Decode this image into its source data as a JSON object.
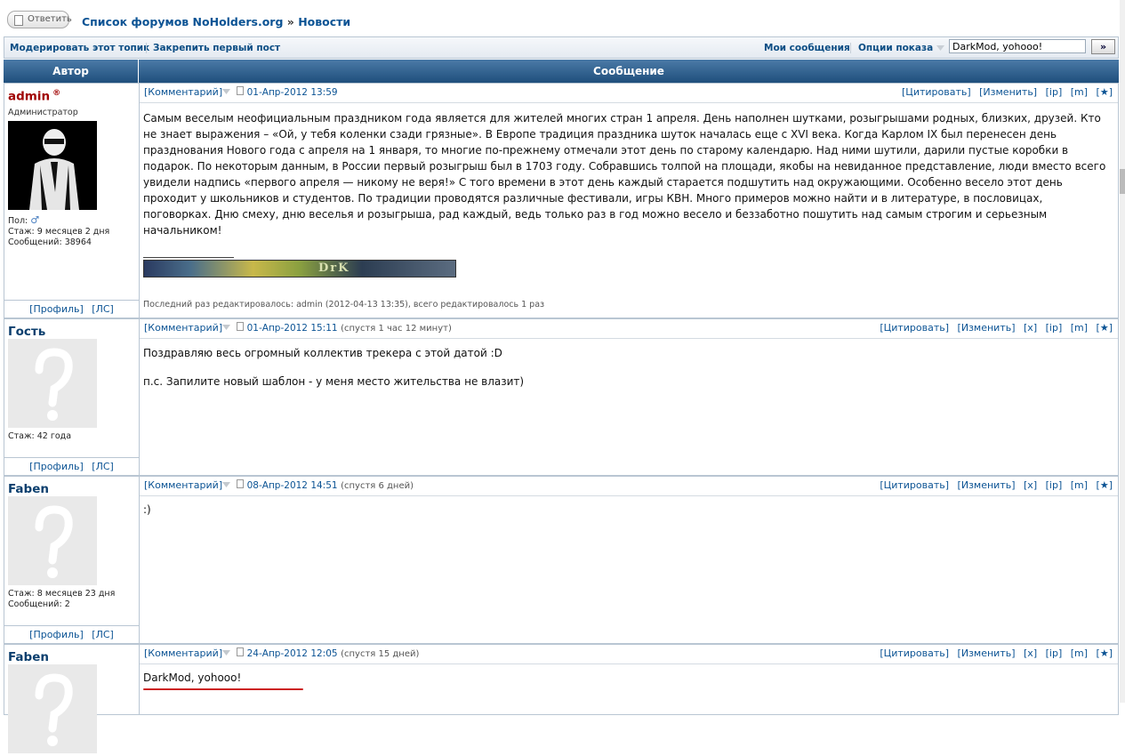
{
  "topbar": {
    "reply_label": "Ответить",
    "breadcrumb_forum": "Список форумов NoHolders.org",
    "breadcrumb_sep": "»",
    "breadcrumb_section": "Новости"
  },
  "toolbar": {
    "moderate": "Модерировать этот топик",
    "pin_first": "Закрепить первый пост",
    "my_posts": "Мои сообщения",
    "view_options": "Опции показа",
    "search_value": "DarkMod, yohooo!",
    "go_label": "»"
  },
  "table_headers": {
    "author": "Автор",
    "message": "Сообщение"
  },
  "post_actions": {
    "comment": "[Комментарий]",
    "quote": "[Цитировать]",
    "edit": "[Изменить]",
    "delete": "[x]",
    "ip": "[ip]",
    "m": "[m]",
    "star": "[★]",
    "profile": "[Профиль]",
    "pm": "[ЛС]"
  },
  "posts": [
    {
      "author": "admin",
      "role": "Администратор",
      "gender_label": "Пол:",
      "stat1": "Стаж: 9 месяцев 2 дня",
      "stat2": "Сообщений: 38964",
      "date": "01-Апр-2012 13:59",
      "body": "Самым веселым неофициальным праздником года является для жителей многих стран 1 апреля. День наполнен шутками, розыгрышами родных, близких, друзей. Кто не знает выражения – «Ой, у тебя коленки сзади грязные». В Европе традиция праздника шуток началась еще с XVI века. Когда Карлом IX был перенесен день празднования Нового года с апреля на 1 января, то многие по-прежнему отмечали этот день по старому календарю. Над ними шутили, дарили пустые коробки в подарок. По некоторым данным, в России первый розыгрыш был в 1703 году. Собравшись толпой на площади, якобы на невиданное представление, люди вместо всего увидели надпись «первого апреля — никому не веря!» С того времени в этот день каждый старается подшутить над окружающими. Особенно весело этот день проходит у школьников и студентов. По традиции проводятся различные фестивали, игры КВН. Много примеров можно найти и в литературе, в пословицах, поговорках. Дню смеху, дню веселья и розыгрыша, рад каждый, ведь только раз в год можно весело и беззаботно пошутить над самым строгим и серьезным начальником!",
      "signature_text": "DrK",
      "edit_info": "Последний раз редактировалось: admin (2012-04-13 13:35), всего редактировалось 1 раз"
    },
    {
      "author": "Гость",
      "stat1": "Стаж: 42 года",
      "date": "01-Апр-2012 15:11",
      "since": "(спустя 1 час 12 минут)",
      "body_line1": "Поздравляю весь огромный коллектив трекера с этой датой :D",
      "body_line2": "п.с. Запилите новый шаблон - у меня место жительства не влазит)"
    },
    {
      "author": "Faben",
      "stat1": "Стаж: 8 месяцев 23 дня",
      "stat2": "Сообщений: 2",
      "date": "08-Апр-2012 14:51",
      "since": "(спустя 6 дней)",
      "body": ":)"
    },
    {
      "author": "Faben",
      "date": "24-Апр-2012 12:05",
      "since": "(спустя 15 дней)",
      "body": "DarkMod, yohooo!"
    }
  ],
  "colors": {
    "header_bg": "#1f4f7c",
    "link": "#0b5394",
    "admin_name": "#a00000",
    "underline_mark": "#cc2222"
  },
  "icons": [
    "checkbox-icon",
    "registered-icon",
    "male-gender-icon",
    "dropdown-arrow-icon",
    "post-link-icon",
    "default-avatar-icon",
    "admin-avatar-icon"
  ]
}
